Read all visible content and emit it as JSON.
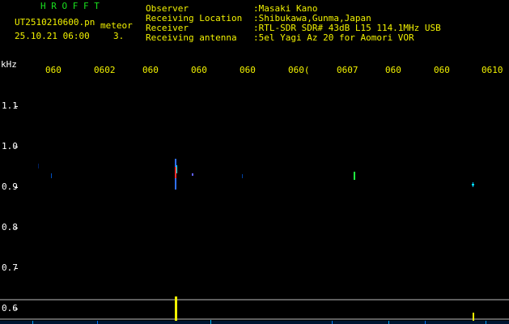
{
  "header": {
    "app_name": "H R O F F T",
    "file_name": "UT2510210600.pn",
    "detection_label": "meteor",
    "date_time": "25.10.21 06:00",
    "count": "3."
  },
  "station_info": [
    {
      "label": "Observer",
      "value": ":Masaki Kano"
    },
    {
      "label": "Receiving Location",
      "value": ":Shibukawa,Gunma,Japan"
    },
    {
      "label": "Receiver",
      "value": ":RTL-SDR SDR# 43dB L15 114.1MHz USB"
    },
    {
      "label": "Receiving antenna",
      "value": ":5el Yagi Az 20 for Aomori VOR"
    }
  ],
  "axes": {
    "y_unit": "kHz",
    "y_ticks": [
      "1.1",
      "1.0",
      "0.9",
      "0.8",
      "0.7",
      "0.6"
    ],
    "x_ticks": [
      "060",
      "0602",
      "060",
      "060",
      "060",
      "060(",
      "0607",
      "060",
      "060",
      "0610"
    ]
  },
  "colors": {
    "background": "#000000",
    "title": "#19e01e",
    "info": "#f2f200",
    "axis": "#ffffff",
    "echo_cyan": "#00c8ff",
    "echo_red": "#ff3030",
    "echo_green": "#20ff40"
  }
}
